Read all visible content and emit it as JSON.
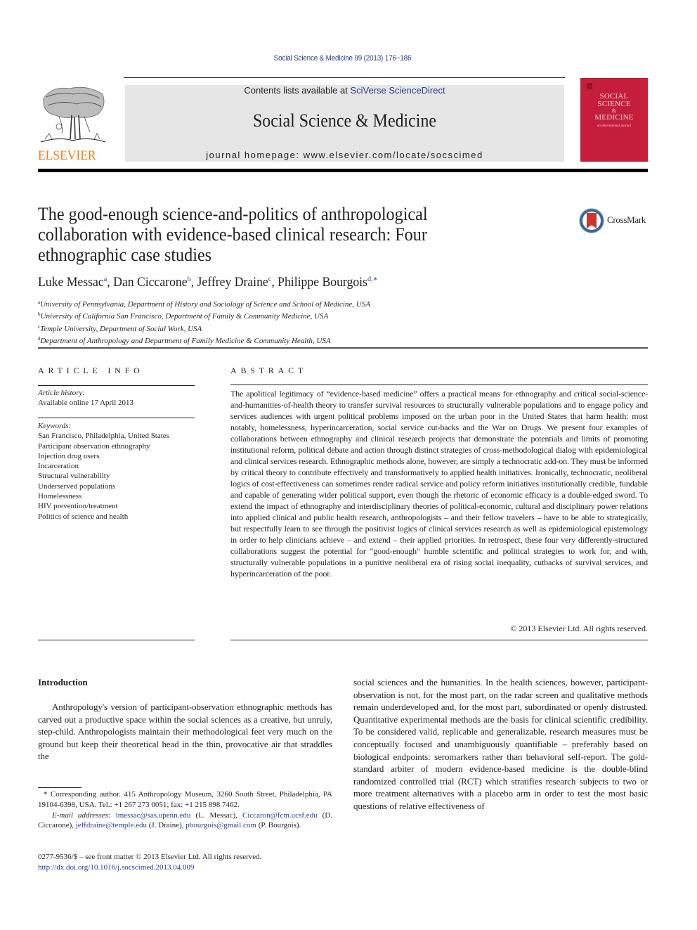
{
  "citation": "Social Science & Medicine 99 (2013) 176−186",
  "header": {
    "publisher_logo_text": "ELSEVIER",
    "contents_prefix": "Contents lists available at ",
    "contents_link": "SciVerse ScienceDirect",
    "journal_title": "Social Science & Medicine",
    "homepage": "journal homepage: www.elsevier.com/locate/socscimed",
    "cover": {
      "title_lines": [
        "SOCIAL",
        "SCIENCE",
        "&",
        "MEDICINE"
      ],
      "subtitle": "an international journal",
      "color": "#c41e3a"
    },
    "crossmark_label": "CrossMark"
  },
  "article": {
    "title": "The good-enough science-and-politics of anthropological collaboration with evidence-based clinical research: Four ethnographic case studies",
    "authors": [
      {
        "name": "Luke Messac",
        "sup": "a"
      },
      {
        "name": "Dan Ciccarone",
        "sup": "b"
      },
      {
        "name": "Jeffrey Draine",
        "sup": "c"
      },
      {
        "name": "Philippe Bourgois",
        "sup": "d,∗"
      }
    ],
    "affiliations": [
      {
        "key": "a",
        "text": "University of Pennsylvania, Department of History and Sociology of Science and School of Medicine, USA"
      },
      {
        "key": "b",
        "text": "University of California San Francisco, Department of Family & Community Medicine, USA"
      },
      {
        "key": "c",
        "text": "Temple University, Department of Social Work, USA"
      },
      {
        "key": "d",
        "text": "Department of Anthropology and Department of Family Medicine & Community Health, USA"
      }
    ]
  },
  "article_info": {
    "heading": "ARTICLE INFO",
    "history_label": "Article history:",
    "history_value": "Available online 17 April 2013",
    "keywords_label": "Keywords:",
    "keywords": [
      "San Francisco, Philadelphia, United States",
      "Participant observation ethnography",
      "Injection drug users",
      "Incarceration",
      "Structural vulnerability",
      "Underserved populations",
      "Homelessness",
      "HIV prevention/treatment",
      "Politics of science and health"
    ]
  },
  "abstract": {
    "heading": "ABSTRACT",
    "text": "The apolitical legitimacy of “evidence-based medicine” offers a practical means for ethnography and critical social-science-and-humanities-of-health theory to transfer survival resources to structurally vulnerable populations and to engage policy and services audiences with urgent political problems imposed on the urban poor in the United States that harm health: most notably, homelessness, hyper­incarceration, social service cut-backs and the War on Drugs. We present four examples of collaborations between ethnography and clinical research projects that demonstrate the potentials and limits of pro­moting institutional reform, political debate and action through distinct strategies of cross-methodological dialog with epidemiological and clinical services research. Ethnographic methods alone, however, are simply a technocratic add-on. They must be informed by critical theory to contribute effectively and transformatively to applied health initiatives. Ironically, technocratic, neoliberal logics of cost-effectiveness can sometimes render radical service and policy reform initiatives institutionally credible, fundable and capable of generating wider political support, even though the rhetoric of eco­nomic efficacy is a double-edged sword. To extend the impact of ethnography and interdisciplinary theories of political-economic, cultural and disciplinary power relations into applied clinical and public health research, anthropologists – and their fellow travelers – have to be able to strategically, but respectfully learn to see through the positivist logics of clinical services research as well as epidemio­logical epistemology in order to help clinicians achieve – and extend – their applied priorities. In retrospect, these four very differently-structured collaborations suggest the potential for \"good-enough\" humble scientific and political strategies to work for, and with, structurally vulnerable populations in a punitive neoliberal era of rising social inequality, cutbacks of survival services, and hyperincarceration of the poor.",
    "copyright": "© 2013 Elsevier Ltd. All rights reserved."
  },
  "body": {
    "intro_heading": "Introduction",
    "col1_text": "Anthropology's version of participant-observation ethnographic methods has carved out a productive space within the social sci­ences as a creative, but unruly, step-child. Anthropologists main­tain their methodological feet very much on the ground but keep their theoretical head in the thin, provocative air that straddles the",
    "col2_text": "social sciences and the humanities. In the health sciences, however, participant-observation is not, for the most part, on the radar screen and qualitative methods remain underdeveloped and, for the most part, subordinated or openly distrusted. Quantitative experimental methods are the basis for clinical scientific credibility. To be considered valid, replicable and generalizable, research measures must be conceptually focused and unambiguously quantifiable – preferably based on biological endpoints: sero­markers rather than behavioral self-report. The gold-standard arbiter of modern evidence-based medicine is the double-blind randomized controlled trial (RCT) which stratifies research sub­jects to two or more treatment alternatives with a placebo arm in order to test the most basic questions of relative effectiveness of"
  },
  "footnotes": {
    "corresponding": "* Corresponding author. 415 Anthropology Museum, 3260 South Street, Phila­delphia, PA 19104-6398, USA. Tel.: +1 267 273 0051; fax: +1 215 898 7462.",
    "email_label": "E-mail addresses:",
    "emails": [
      {
        "address": "lmessac@sas.upenn.edu",
        "owner": "(L. Messac),"
      },
      {
        "address": "Ciccaron@fcm.ucsf.edu",
        "owner": "(D. Ciccarone),"
      },
      {
        "address": "jeffdraine@temple.edu",
        "owner": "(J. Draine),"
      },
      {
        "address": "pbourgois@gmail.com",
        "owner": "(P. Bourgois)."
      }
    ],
    "issn_line": "0277-9536/$ – see front matter © 2013 Elsevier Ltd. All rights reserved.",
    "doi": "http://dx.doi.org/10.1016/j.socscimed.2013.04.009"
  },
  "colors": {
    "link": "#2a3c8e",
    "elsevier_orange": "#f47c20",
    "header_box": "#e6e6e6",
    "cover_red": "#c41e3a"
  }
}
